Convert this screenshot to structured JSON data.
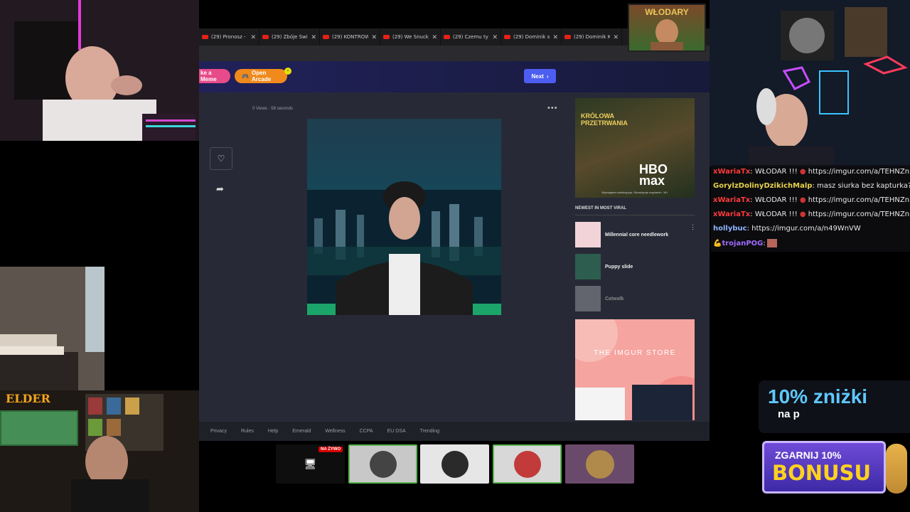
{
  "tabs": [
    {
      "title": "(29) Pronosz -"
    },
    {
      "title": "(29) Zbóje Świ"
    },
    {
      "title": "(29) KONTROW"
    },
    {
      "title": "(29) We Snuck"
    },
    {
      "title": "(29) Czemu ty"
    },
    {
      "title": "(29) Dominik s"
    },
    {
      "title": "(29) Dominik K"
    }
  ],
  "imgur": {
    "meme_label": "ke a Meme",
    "arcade_label": "Open Arcade",
    "next_label": "Next",
    "meta": "0 Views · 58 seconds",
    "newest_title": "NEWEST IN MOST VIRAL",
    "viral": [
      {
        "name": "Millennial core needlework"
      },
      {
        "name": "Puppy slide"
      },
      {
        "name": "Catwalk"
      }
    ],
    "ad1": {
      "line1": "KRÓLOWA",
      "line2": "PRZETRWANIA",
      "brand1": "HBO",
      "brand2": "max",
      "fine": "Wymagana subskrypcja. Obowiązuje regulamin. 18+"
    },
    "ad2_label": "THE IMGUR STORE",
    "footer": [
      "Privacy",
      "Rules",
      "Help",
      "Emerald",
      "Wellness",
      "CCPA",
      "EU DSA",
      "Trending"
    ]
  },
  "taskbar": {
    "live_badge": "NA ŻYWO"
  },
  "chat": [
    {
      "user": "xWariaTx",
      "color": "#ff3b3b",
      "text": ": WŁODAR !!! ",
      "link": "https://imgur.com/a/TEHNZnK"
    },
    {
      "user": "GorylzDolinyDzikichMalp",
      "color": "#e6d34b",
      "text": ": masz siurka bez kapturka?",
      "link": ""
    },
    {
      "user": "xWariaTx",
      "color": "#ff3b3b",
      "text": ": WŁODAR !!! ",
      "link": "https://imgur.com/a/TEHNZnK"
    },
    {
      "user": "xWariaTx",
      "color": "#ff3b3b",
      "text": ": WŁODAR !!! ",
      "link": "https://imgur.com/a/TEHNZnK"
    },
    {
      "user": "hollybuc",
      "color": "#8fb4ff",
      "text": ": https://imgur.com/a/n49WnVW",
      "link": ""
    },
    {
      "user": "trojanPOG",
      "color": "#a06cff",
      "text": ":",
      "link": ""
    }
  ],
  "overlay": {
    "promo": "10% zniżki",
    "promo_sub": "na p",
    "bonus_a": "ZGARNIJ 10%",
    "bonus_b": "BONUSU",
    "banner": "WŁODARY",
    "elder": "ELDER"
  }
}
